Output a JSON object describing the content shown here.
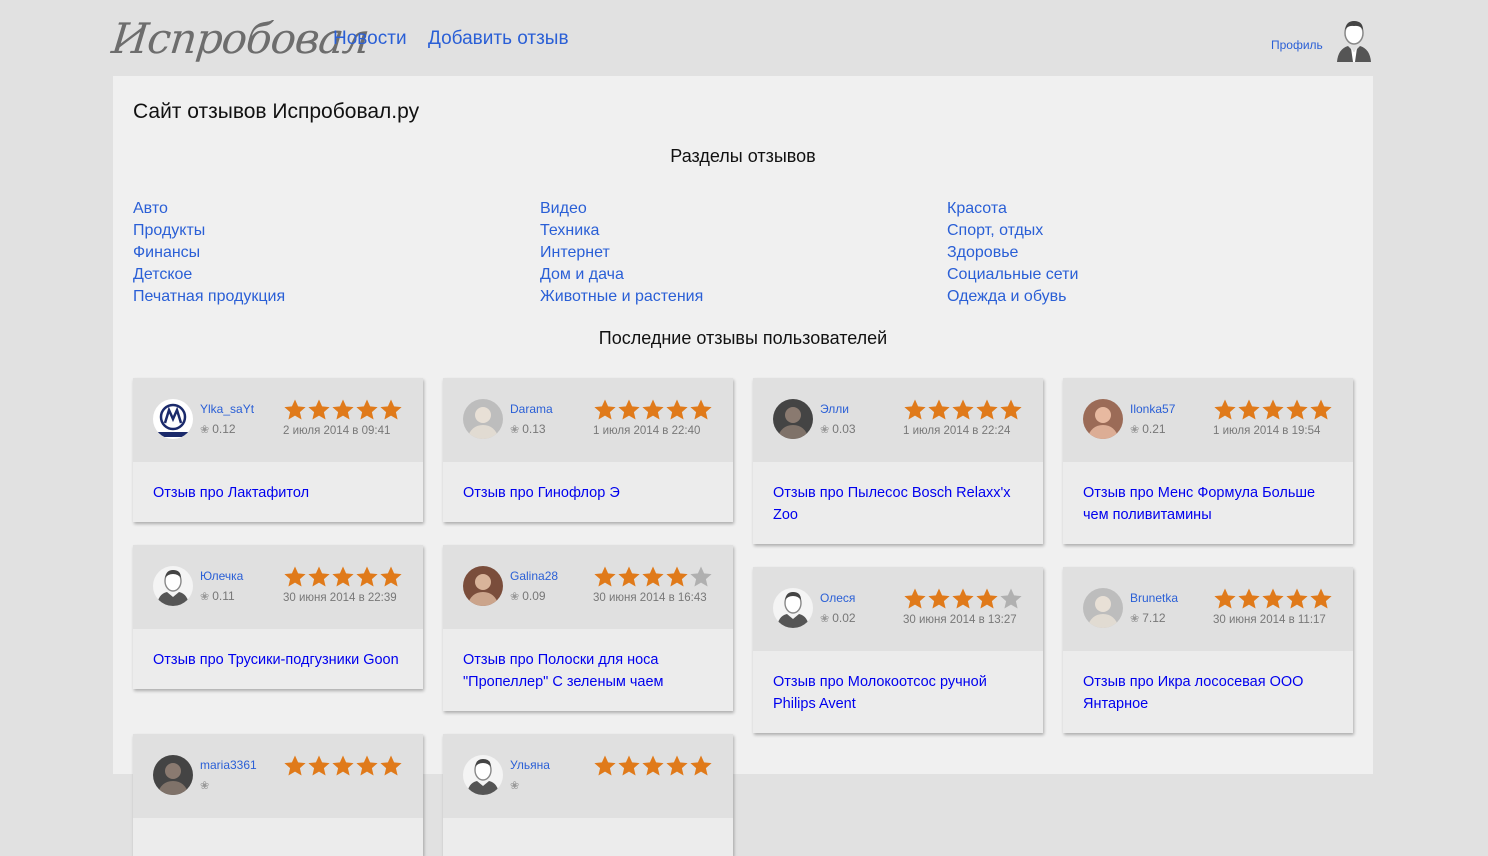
{
  "header": {
    "logo": "Испробовал",
    "nav": [
      "Новости",
      "Добавить отзыв"
    ],
    "profile": "Профиль"
  },
  "page_title": "Сайт отзывов Испробовал.ру",
  "sections_title": "Разделы отзывов",
  "categories": [
    [
      "Авто",
      "Продукты",
      "Финансы",
      "Детское",
      "Печатная продукция"
    ],
    [
      "Видео",
      "Техника",
      "Интернет",
      "Дом и дача",
      "Животные и растения"
    ],
    [
      "Красота",
      "Спорт, отдых",
      "Здоровье",
      "Социальные сети",
      "Одежда и обувь"
    ]
  ],
  "reviews_title": "Последние отзывы пользователей",
  "colors": {
    "link": "#2a5fd6",
    "star": "#e07a1a",
    "star_empty": "#b0b0b0"
  },
  "reviews": [
    {
      "user": "Ylka_saYt",
      "rating": "0.12",
      "stars": 5,
      "date": "2 июля 2014 в 09:41",
      "title": "Отзыв про Лактафитол",
      "avatar": "motorola-logo-icon"
    },
    {
      "user": "Darama",
      "rating": "0.13",
      "stars": 5,
      "date": "1 июля 2014 в 22:40",
      "title": "Отзыв про Гинофлор Э",
      "avatar": "photo-avatar-icon"
    },
    {
      "user": "Элли",
      "rating": "0.03",
      "stars": 5,
      "date": "1 июля 2014 в 22:24",
      "title": "Отзыв про Пылесос Bosch Relaxx'x Zoo",
      "avatar": "photo-avatar-icon"
    },
    {
      "user": "Ilonka57",
      "rating": "0.21",
      "stars": 5,
      "date": "1 июля 2014 в 19:54",
      "title": "Отзыв про Менс Формула Больше чем поливитамины",
      "avatar": "photo-avatar-icon"
    },
    {
      "user": "Юлечка",
      "rating": "0.11",
      "stars": 5,
      "date": "30 июня 2014 в 22:39",
      "title": "Отзыв про Трусики-подгузники Goon",
      "avatar": "default-user-icon"
    },
    {
      "user": "Galina28",
      "rating": "0.09",
      "stars": 4,
      "date": "30 июня 2014 в 16:43",
      "title": "Отзыв про Полоски для носа \"Пропеллер\" С зеленым чаем",
      "avatar": "photo-avatar-icon"
    },
    {
      "user": "Олеся",
      "rating": "0.02",
      "stars": 4,
      "date": "30 июня 2014 в 13:27",
      "title": "Отзыв про Молокоотсос ручной Philips Avent",
      "avatar": "default-user-icon"
    },
    {
      "user": "Brunetka",
      "rating": "7.12",
      "stars": 5,
      "date": "30 июня 2014 в 11:17",
      "title": "Отзыв про Икра лососевая ООО Янтарное",
      "avatar": "photo-avatar-icon"
    },
    {
      "user": "maria3361",
      "rating": "",
      "stars": 5,
      "date": "",
      "title": "",
      "avatar": "photo-avatar-icon"
    },
    {
      "user": "Ульяна",
      "rating": "",
      "stars": 5,
      "date": "",
      "title": "",
      "avatar": "default-user-icon"
    }
  ]
}
